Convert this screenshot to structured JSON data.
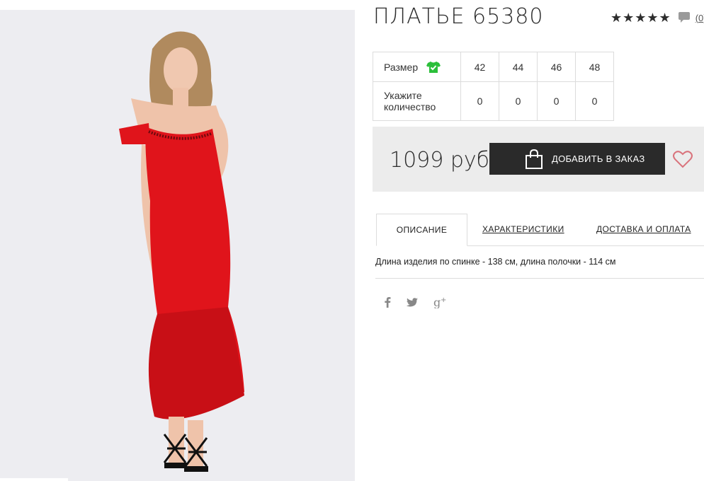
{
  "product": {
    "title": "ПЛАТЬЕ 65380",
    "rating_stars": "★★★★★",
    "comment_count": "(0)",
    "price": "1099 руб"
  },
  "size_table": {
    "size_label": "Размер",
    "qty_label": "Укажите количество",
    "sizes": [
      "42",
      "44",
      "46",
      "48"
    ],
    "quantities": [
      "0",
      "0",
      "0",
      "0"
    ]
  },
  "cart": {
    "add_label": "ДОБАВИТЬ В ЗАКАЗ"
  },
  "tabs": [
    {
      "label": "ОПИСАНИЕ",
      "active": true
    },
    {
      "label": "ХАРАКТЕРИСТИКИ",
      "active": false
    },
    {
      "label": "ДОСТАВКА И ОПЛАТА",
      "active": false
    }
  ],
  "description": "Длина изделия по спинке - 138 см, длина полочки - 114 см",
  "social": [
    "facebook-icon",
    "twitter-icon",
    "google-plus-icon"
  ],
  "colors": {
    "dress": "#e0141b",
    "button_bg": "#2a2a2a",
    "panel_bg": "#ececec",
    "tshirt_icon": "#2bbf3a",
    "heart": "#d9737c"
  }
}
